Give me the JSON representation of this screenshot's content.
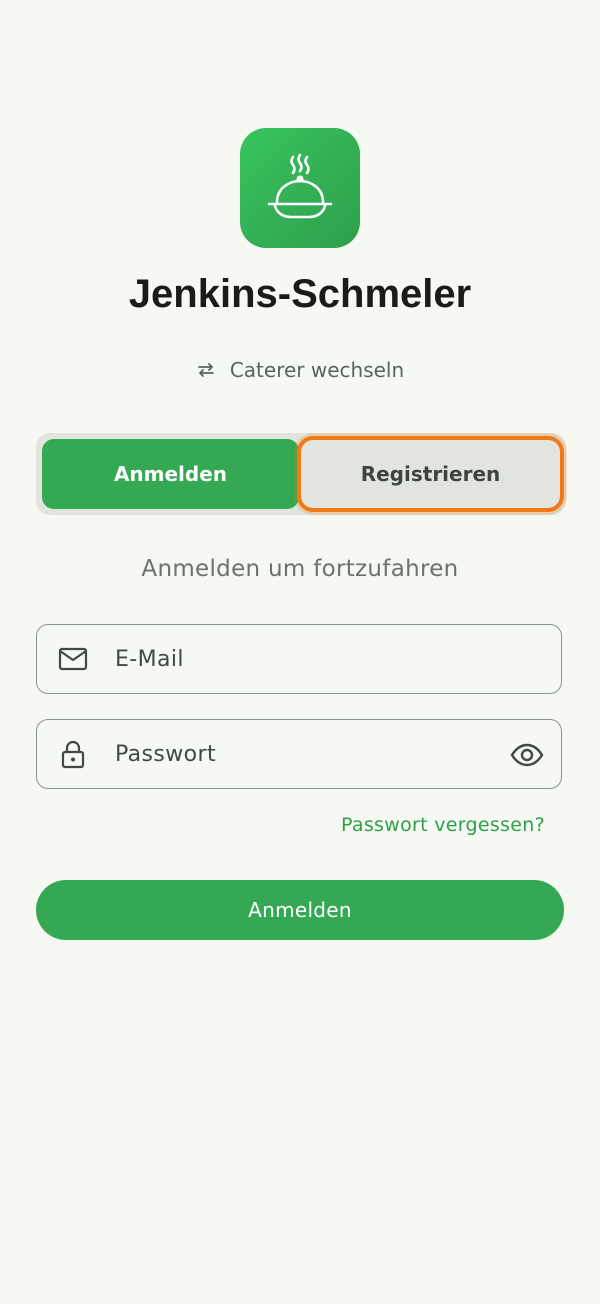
{
  "brand": {
    "name": "Jenkins-Schmeler",
    "icon": "cloche-icon",
    "accent_color": "#34a853"
  },
  "switch_caterer": {
    "label": "Caterer wechseln",
    "icon": "swap-arrows-icon"
  },
  "auth_tabs": {
    "login_label": "Anmelden",
    "register_label": "Registrieren",
    "selected": "Anmelden",
    "highlight_color": "#f27a16"
  },
  "form": {
    "subtitle": "Anmelden um fortzufahren",
    "email": {
      "placeholder": "E-Mail",
      "value": "",
      "icon": "mail-icon"
    },
    "password": {
      "placeholder": "Passwort",
      "value": "",
      "icon": "lock-icon",
      "toggle_icon": "eye-icon"
    },
    "forgot_label": "Passwort vergessen?",
    "submit_label": "Anmelden"
  }
}
